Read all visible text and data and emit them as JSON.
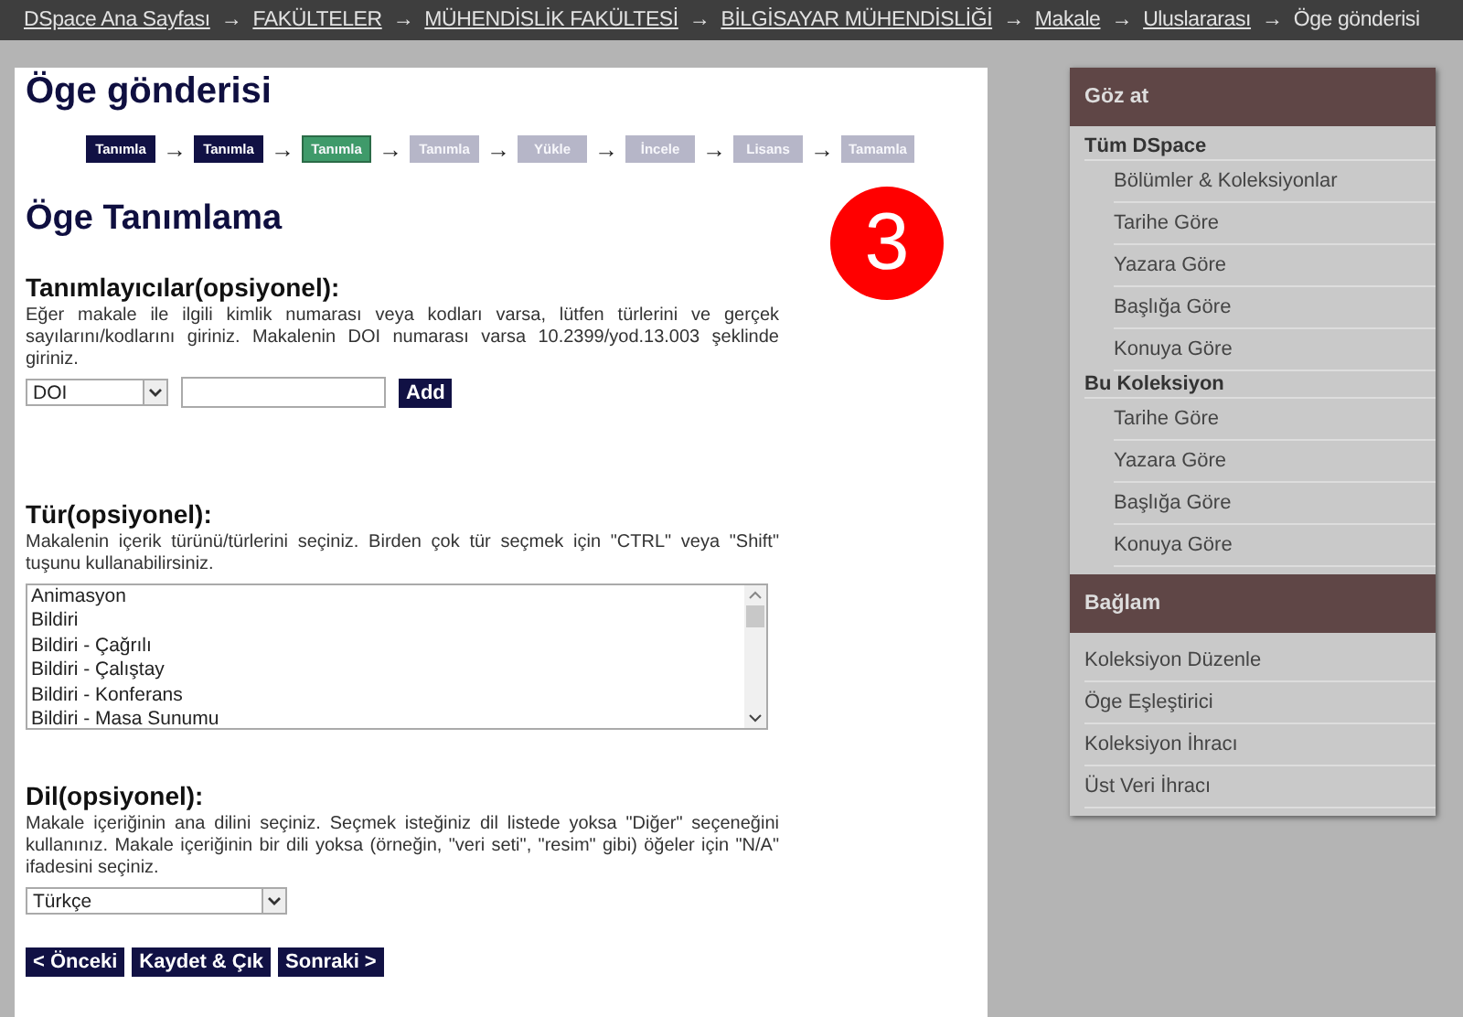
{
  "breadcrumb": [
    {
      "label": "DSpace Ana Sayfası",
      "link": true
    },
    {
      "label": "FAKÜLTELER",
      "link": true
    },
    {
      "label": "MÜHENDİSLİK FAKÜLTESİ",
      "link": true
    },
    {
      "label": "BİLGİSAYAR MÜHENDİSLİĞİ",
      "link": true
    },
    {
      "label": "Makale",
      "link": true
    },
    {
      "label": "Uluslararası",
      "link": true
    },
    {
      "label": "Öge gönderisi",
      "link": false
    }
  ],
  "breadcrumb_separator": "→",
  "page_title": "Öge gönderisi",
  "steps": [
    {
      "label": "Tanımla",
      "completed": true,
      "selected": false
    },
    {
      "label": "Tanımla",
      "completed": true,
      "selected": false
    },
    {
      "label": "Tanımla",
      "completed": false,
      "selected": true
    },
    {
      "label": "Tanımla",
      "completed": false,
      "selected": false
    },
    {
      "label": "Yükle",
      "completed": false,
      "selected": false
    },
    {
      "label": "İncele",
      "completed": false,
      "selected": false
    },
    {
      "label": "Lisans",
      "completed": false,
      "selected": false
    },
    {
      "label": "Tamamla",
      "completed": false,
      "selected": false
    }
  ],
  "step_separator": "→",
  "step_badge": "3",
  "section_title": "Öge Tanımlama",
  "identifiers": {
    "label": "Tanımlayıcılar(opsiyonel):",
    "help": "Eğer makale ile ilgili kimlik numarası veya kodları varsa, lütfen türlerini ve gerçek sayılarını/kodlarını giriniz. Makalenin DOI numarası varsa 10.2399/yod.13.003 şeklinde giriniz.",
    "type_value": "DOI",
    "add_button": "Add"
  },
  "type": {
    "label": "Tür(opsiyonel):",
    "help": "Makalenin içerik türünü/türlerini seçiniz. Birden çok tür seçmek için \"CTRL\" veya \"Shift\" tuşunu kullanabilirsiniz.",
    "options": [
      "Animasyon",
      "Bildiri",
      "Bildiri - Çağrılı",
      "Bildiri - Çalıştay",
      "Bildiri - Konferans",
      "Bildiri - Masa Sunumu"
    ]
  },
  "language": {
    "label": "Dil(opsiyonel):",
    "help": "Makale içeriğinin ana dilini seçiniz. Seçmek isteğiniz dil listede yoksa \"Diğer\" seçeneğini kullanınız. Makale içeriğinin bir dili yoksa (örneğin, \"veri seti\", \"resim\" gibi) öğeler için \"N/A\" ifadesini seçiniz.",
    "value": "Türkçe"
  },
  "buttons": [
    "< Önceki",
    "Kaydet & Çık",
    "Sonraki >"
  ],
  "sidebar": {
    "sections": [
      {
        "title": "Göz at",
        "groups": [
          {
            "label": "Tüm DSpace",
            "children": [
              "Bölümler & Koleksiyonlar",
              "Tarihe Göre",
              "Yazara Göre",
              "Başlığa Göre",
              "Konuya Göre"
            ]
          },
          {
            "label": "Bu Koleksiyon",
            "children": [
              "Tarihe Göre",
              "Yazara Göre",
              "Başlığa Göre",
              "Konuya Göre"
            ]
          }
        ]
      },
      {
        "title": "Bağlam",
        "items": [
          "Koleksiyon Düzenle",
          "Öge Eşleştirici",
          "Koleksiyon İhracı",
          "Üst Veri İhracı"
        ]
      }
    ]
  }
}
